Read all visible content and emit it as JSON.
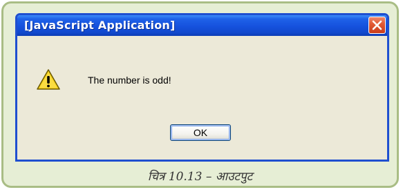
{
  "dialog": {
    "title": "[JavaScript Application]",
    "message": "The number is odd!",
    "ok_label": "OK",
    "icon": "warning-icon",
    "close_icon": "close-icon"
  },
  "caption": {
    "text": "चित्र 10.13 – आउटपुट"
  },
  "colors": {
    "title_bar": "#1551dd",
    "window_border": "#1f4fd0",
    "dialog_body": "#ece9d8",
    "close_button": "#e25b36",
    "frame_background": "#e6eed5",
    "frame_border": "#a9bd85",
    "warning_yellow": "#f7d21e"
  }
}
